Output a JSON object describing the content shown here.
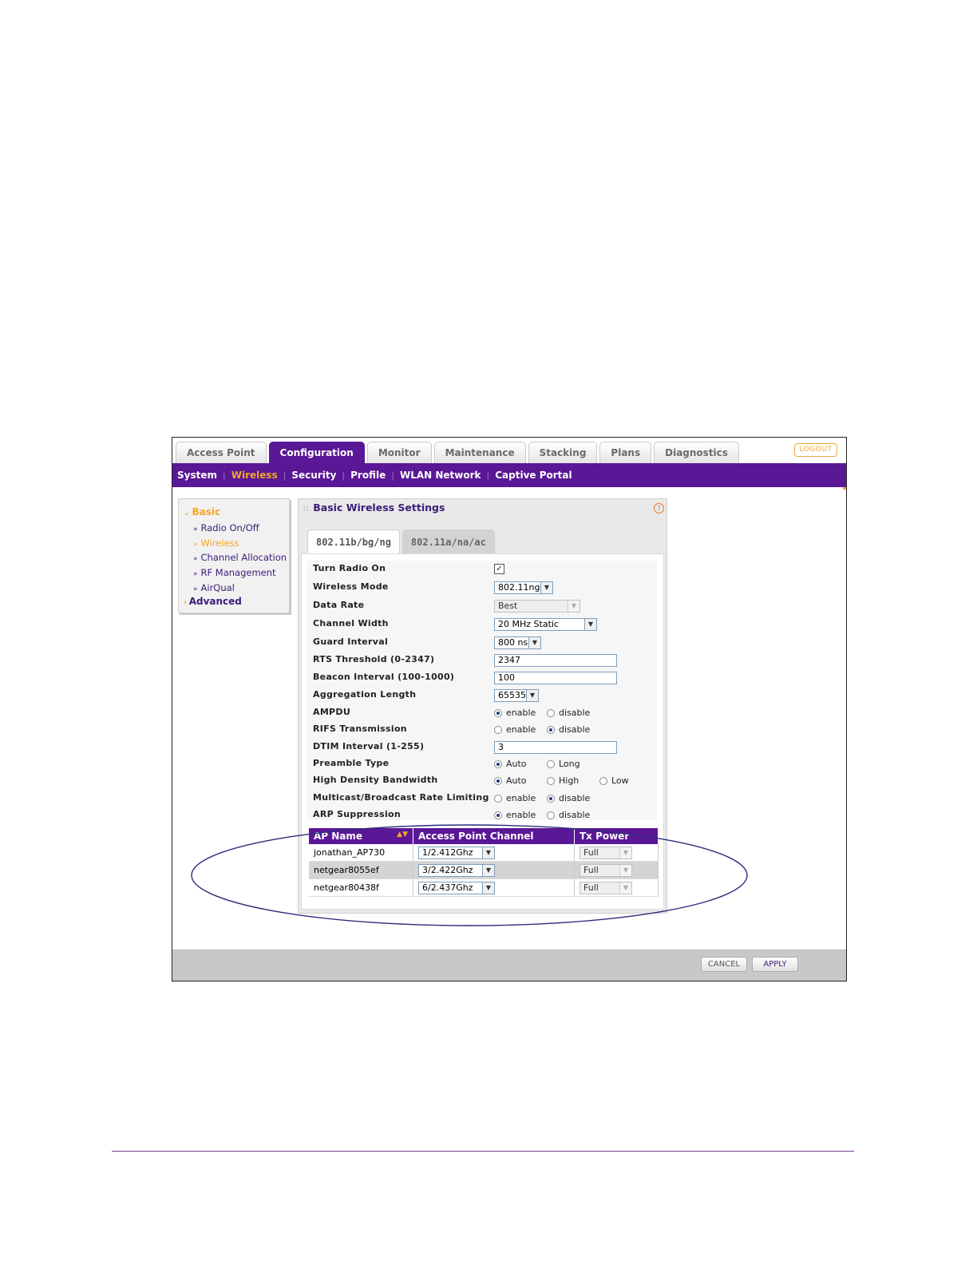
{
  "top_tabs": [
    "Access Point",
    "Configuration",
    "Monitor",
    "Maintenance",
    "Stacking",
    "Plans",
    "Diagnostics"
  ],
  "active_top_tab": "Configuration",
  "logout_label": "LOGOUT",
  "sub_nav": [
    "System",
    "Wireless",
    "Security",
    "Profile",
    "WLAN Network",
    "Captive Portal"
  ],
  "active_sub_nav": "Wireless",
  "left_nav": {
    "basic_label": "Basic",
    "items": [
      "Radio On/Off",
      "Wireless",
      "Channel Allocation",
      "RF Management",
      "AirQual"
    ],
    "active_item": "Wireless",
    "advanced_label": "Advanced"
  },
  "panel": {
    "title": "Basic Wireless Settings",
    "tabs": [
      "802.11b/bg/ng",
      "802.11a/na/ac"
    ],
    "active_tab": "802.11b/bg/ng"
  },
  "settings": {
    "turn_radio_on": {
      "label": "Turn Radio On",
      "checked": true
    },
    "wireless_mode": {
      "label": "Wireless Mode",
      "value": "802.11ng"
    },
    "data_rate": {
      "label": "Data Rate",
      "value": "Best"
    },
    "channel_width": {
      "label": "Channel Width",
      "value": "20 MHz Static"
    },
    "guard_interval": {
      "label": "Guard Interval",
      "value": "800 ns"
    },
    "rts_threshold": {
      "label": "RTS Threshold (0-2347)",
      "value": "2347"
    },
    "beacon_interval": {
      "label": "Beacon Interval (100-1000)",
      "value": "100"
    },
    "aggregation_length": {
      "label": "Aggregation Length",
      "value": "65535"
    },
    "ampdu": {
      "label": "AMPDU",
      "options": [
        "enable",
        "disable"
      ],
      "selected": "enable"
    },
    "rifs": {
      "label": "RIFS Transmission",
      "options": [
        "enable",
        "disable"
      ],
      "selected": "disable"
    },
    "dtim": {
      "label": "DTIM Interval (1-255)",
      "value": "3"
    },
    "preamble": {
      "label": "Preamble Type",
      "options": [
        "Auto",
        "Long"
      ],
      "selected": "Auto"
    },
    "hdb": {
      "label": "High Density Bandwidth",
      "options": [
        "Auto",
        "High",
        "Low"
      ],
      "selected": "Auto"
    },
    "mbrl": {
      "label": "Multicast/Broadcast Rate Limiting",
      "options": [
        "enable",
        "disable"
      ],
      "selected": "disable"
    },
    "arp": {
      "label": "ARP Suppression",
      "options": [
        "enable",
        "disable"
      ],
      "selected": "enable"
    }
  },
  "ap_table": {
    "headers": [
      "AP Name",
      "Access Point Channel",
      "Tx Power"
    ],
    "rows": [
      {
        "name": "jonathan_AP730",
        "channel": "1/2.412Ghz",
        "power": "Full"
      },
      {
        "name": "netgear8055ef",
        "channel": "3/2.422Ghz",
        "power": "Full"
      },
      {
        "name": "netgear80438f",
        "channel": "6/2.437Ghz",
        "power": "Full"
      }
    ]
  },
  "buttons": {
    "cancel": "CANCEL",
    "apply": "APPLY"
  },
  "colors": {
    "brand_purple": "#5a1796",
    "accent_orange": "#f5a623",
    "link_purple": "#3a1c78",
    "highlight_ellipse": "#2b2d7c"
  }
}
